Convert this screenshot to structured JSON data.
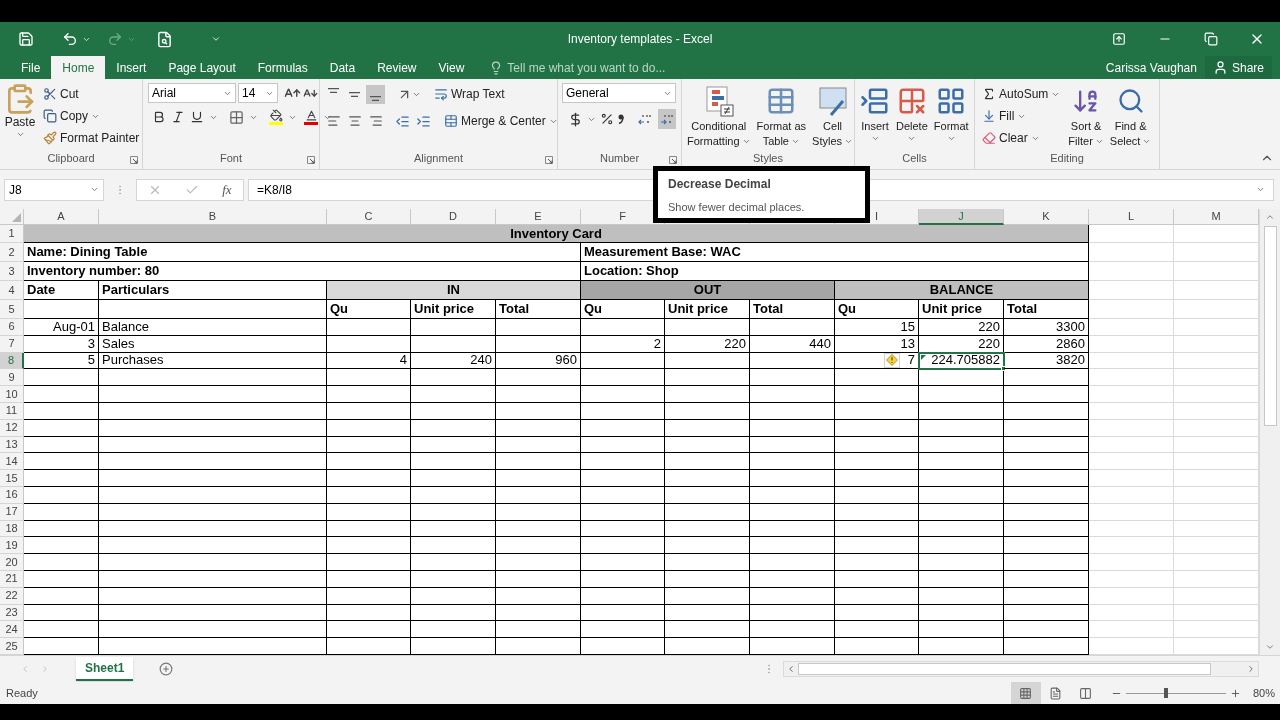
{
  "window": {
    "title": "Inventory templates - Excel",
    "user": "Carissa Vaughan"
  },
  "share_button": "Share",
  "ribbon_tabs": [
    {
      "label": "File",
      "selected": false
    },
    {
      "label": "Home",
      "selected": true
    },
    {
      "label": "Insert",
      "selected": false
    },
    {
      "label": "Page Layout",
      "selected": false
    },
    {
      "label": "Formulas",
      "selected": false
    },
    {
      "label": "Data",
      "selected": false
    },
    {
      "label": "Review",
      "selected": false
    },
    {
      "label": "View",
      "selected": false
    }
  ],
  "tell_me": {
    "placeholder": "Tell me what you want to do..."
  },
  "clipboard": {
    "label": "Clipboard",
    "paste": "Paste",
    "cut": "Cut",
    "copy": "Copy",
    "format_painter": "Format Painter"
  },
  "font": {
    "label": "Font",
    "family": "Arial",
    "size": "14"
  },
  "alignment": {
    "label": "Alignment",
    "vertical_align": [
      {
        "selected": false
      },
      {
        "selected": false
      },
      {
        "selected": true
      }
    ],
    "wrap_text": "Wrap Text",
    "merge_center": "Merge & Center"
  },
  "number": {
    "label": "Number",
    "format": "General",
    "decimal_buttons": [
      {
        "highlighted": false
      },
      {
        "highlighted": true
      }
    ]
  },
  "styles": {
    "label": "Styles",
    "conditional_formatting": [
      "Conditional",
      "Formatting"
    ],
    "format_as_table": [
      "Format as",
      "Table"
    ],
    "cell_styles": [
      "Cell",
      "Styles"
    ]
  },
  "cells": {
    "label": "Cells",
    "insert": "Insert",
    "delete": "Delete",
    "format": "Format"
  },
  "editing": {
    "label": "Editing",
    "autosum": "AutoSum",
    "fill": "Fill",
    "clear": "Clear",
    "sort_filter": [
      "Sort &",
      "Filter"
    ],
    "find_select": [
      "Find &",
      "Select"
    ]
  },
  "tooltip": {
    "title": "Decrease Decimal",
    "text": "Show fewer decimal places."
  },
  "formula_bar": {
    "name_box": "J8",
    "function_label": "fx",
    "formula": "=K8/I8"
  },
  "columns": [
    {
      "label": "A",
      "selected": false
    },
    {
      "label": "B",
      "selected": false
    },
    {
      "label": "C",
      "selected": false
    },
    {
      "label": "D",
      "selected": false
    },
    {
      "label": "E",
      "selected": false
    },
    {
      "label": "F",
      "selected": false
    },
    {
      "selected": false
    },
    {
      "selected": false
    },
    {
      "label": "I",
      "selected": false
    },
    {
      "label": "J",
      "selected": true
    },
    {
      "label": "K",
      "selected": false
    },
    {
      "label": "L",
      "selected": false
    },
    {
      "label": "M",
      "selected": false
    }
  ],
  "rows": [
    {
      "label": "1",
      "selected": false
    },
    {
      "label": "2",
      "selected": false
    },
    {
      "label": "3",
      "selected": false
    },
    {
      "label": "4",
      "selected": false
    },
    {
      "label": "5",
      "selected": false
    },
    {
      "label": "6",
      "selected": false
    },
    {
      "label": "7",
      "selected": false
    },
    {
      "label": "8",
      "selected": true
    },
    {
      "label": "9",
      "selected": false
    },
    {
      "label": "10",
      "selected": false
    },
    {
      "label": "11",
      "selected": false
    },
    {
      "label": "12",
      "selected": false
    },
    {
      "label": "13",
      "selected": false
    },
    {
      "label": "14",
      "selected": false
    },
    {
      "label": "15",
      "selected": false
    },
    {
      "label": "16",
      "selected": false
    },
    {
      "label": "17",
      "selected": false
    },
    {
      "label": "18",
      "selected": false
    },
    {
      "label": "19",
      "selected": false
    },
    {
      "label": "20",
      "selected": false
    },
    {
      "label": "21",
      "selected": false
    },
    {
      "label": "22",
      "selected": false
    },
    {
      "label": "23",
      "selected": false
    },
    {
      "label": "24",
      "selected": false
    },
    {
      "label": "25",
      "selected": false
    }
  ],
  "sheet": {
    "title": "Inventory Card",
    "info": [
      [
        "Name: Dining Table",
        "Measurement Base: WAC"
      ],
      [
        "Inventory number: 80",
        "Location: Shop"
      ]
    ],
    "date_header": "Date",
    "particulars_header": "Particulars",
    "sections": [
      {
        "label": "IN",
        "color": "#d9d9d9"
      },
      {
        "label": "OUT",
        "color": "#a6a6a6"
      },
      {
        "label": "BALANCE",
        "color": "#bfbfbf"
      }
    ],
    "subheaders": [
      "Qu",
      "Unit price",
      "Total",
      "Qu",
      "Unit price",
      "Total",
      "Qu",
      "Unit price",
      "Total"
    ],
    "entries": [
      {
        "date": "Aug-01",
        "particulars": "Balance",
        "balance_qu": "15",
        "balance_unit_price": "220",
        "balance_total": "3300",
        "warning": false
      },
      {
        "date": "3",
        "particulars": "Sales",
        "out_qu": "2",
        "out_unit_price": "220",
        "out_total": "440",
        "balance_qu": "13",
        "balance_unit_price": "220",
        "balance_total": "2860",
        "warning": false
      },
      {
        "date": "5",
        "particulars": "Purchases",
        "in_qu": "4",
        "in_unit_price": "240",
        "in_total": "960",
        "balance_qu": "7",
        "balance_unit_price": "224.705882",
        "balance_total": "3820",
        "warning": true
      }
    ]
  },
  "sheet_tabs": [
    {
      "label": "Sheet1",
      "selected": true
    }
  ],
  "status_bar": {
    "status": "Ready",
    "views": [
      {
        "selected": true
      },
      {
        "selected": false
      },
      {
        "selected": false
      }
    ],
    "zoom": "80%",
    "level": 0.38
  }
}
